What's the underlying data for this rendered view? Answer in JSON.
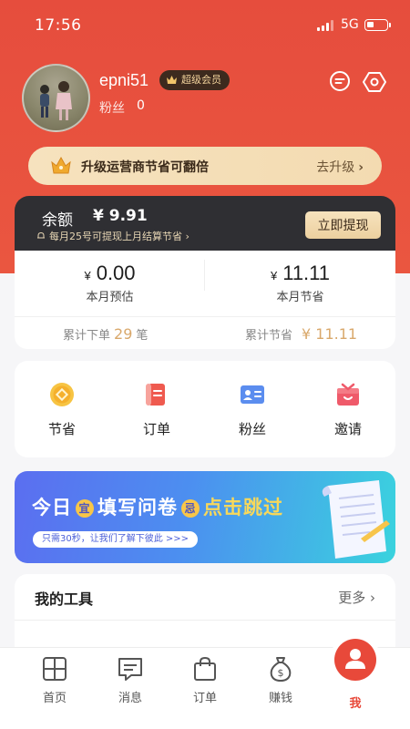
{
  "status": {
    "time": "17:56",
    "network": "5G"
  },
  "profile": {
    "username": "epni51",
    "vip_badge": "超级会员",
    "fans_label": "粉丝",
    "fans_count": "0"
  },
  "upgrade": {
    "text": "升级运营商节省可翻倍",
    "action": "去升级"
  },
  "balance": {
    "label": "余额",
    "amount": "¥ 9.91",
    "note": "每月25号可提现上月结算节省",
    "withdraw_button": "立即提现"
  },
  "stats": {
    "currency": "¥",
    "estimate_value": "0.00",
    "estimate_label": "本月预估",
    "saved_value": "11.11",
    "saved_label": "本月节省",
    "orders_prefix": "累计下单",
    "orders_count": "29",
    "orders_unit": "笔",
    "total_saved_label": "累计节省",
    "total_saved_value": "¥ 11.11"
  },
  "quick_actions": [
    {
      "label": "节省",
      "icon": "coin-icon",
      "color": "#f5b93a"
    },
    {
      "label": "订单",
      "icon": "order-icon",
      "color": "#ef5a4f"
    },
    {
      "label": "粉丝",
      "icon": "fans-card-icon",
      "color": "#5b8def"
    },
    {
      "label": "邀请",
      "icon": "gift-icon",
      "color": "#ef5a6a"
    }
  ],
  "banner": {
    "title_a": "今日",
    "badge_a": "宜",
    "title_b": "填写问卷",
    "badge_b": "忌",
    "title_c": "点击跳过",
    "subtitle": "只需30秒，让我们了解下彼此 >>>"
  },
  "tools": {
    "title": "我的工具",
    "more": "更多"
  },
  "tabbar": [
    {
      "label": "首页",
      "icon": "home-grid-icon"
    },
    {
      "label": "消息",
      "icon": "message-icon"
    },
    {
      "label": "订单",
      "icon": "bag-icon"
    },
    {
      "label": "赚钱",
      "icon": "money-bag-icon"
    },
    {
      "label": "我",
      "icon": "profile-icon"
    }
  ],
  "colors": {
    "primary": "#e8493a",
    "gold": "#d9a86b",
    "dark": "#2f2f33"
  }
}
